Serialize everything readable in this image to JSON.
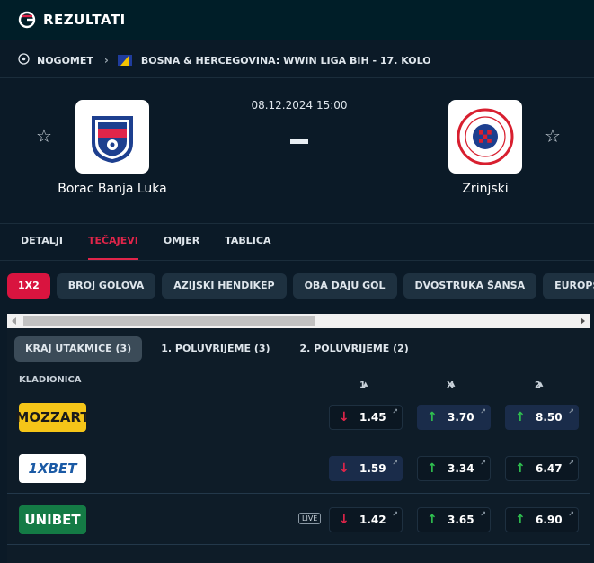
{
  "brand": {
    "name": "REZULTATI"
  },
  "breadcrumb": {
    "sport": "NOGOMET",
    "league": "BOSNA & HERCEGOVINA: WWIN LIGA BIH - 17. KOLO"
  },
  "match": {
    "datetime": "08.12.2024 15:00",
    "score": "-",
    "home": {
      "name": "Borac Banja Luka",
      "logo_text": "BORAC"
    },
    "away": {
      "name": "Zrinjski",
      "logo_text": "ZRINJSKI"
    }
  },
  "tabs": [
    "DETALJI",
    "TEČAJEVI",
    "OMJER",
    "TABLICA"
  ],
  "active_tab": "TEČAJEVI",
  "markets": [
    "1X2",
    "BROJ GOLOVA",
    "AZIJSKI HENDIKEP",
    "OBA DAJU GOL",
    "DVOSTRUKA ŠANSA",
    "EUROPSKI HENDIKEP"
  ],
  "periods": [
    "KRAJ UTAKMICE (3)",
    "1. POLUVRIJEME (3)",
    "2. POLUVRIJEME (2)"
  ],
  "table": {
    "headers": {
      "bookmaker": "KLADIONICA",
      "c1": "1",
      "cx": "X",
      "c2": "2"
    },
    "rows": [
      {
        "bookmaker": "MOZZART",
        "odds": [
          "1.45",
          "3.70",
          "8.50"
        ],
        "dirs": [
          "down",
          "up",
          "up"
        ],
        "live": ""
      },
      {
        "bookmaker": "1XBET",
        "odds": [
          "1.59",
          "3.34",
          "6.47"
        ],
        "dirs": [
          "down",
          "up",
          "up"
        ],
        "live": ""
      },
      {
        "bookmaker": "UNIBET",
        "odds": [
          "1.42",
          "3.65",
          "6.90"
        ],
        "dirs": [
          "down",
          "up",
          "up"
        ],
        "live": "LIVE"
      }
    ]
  },
  "colors": {
    "accent": "#d9143f",
    "background": "#0b1a27",
    "up": "#2fbf4f",
    "down": "#e0254a"
  }
}
